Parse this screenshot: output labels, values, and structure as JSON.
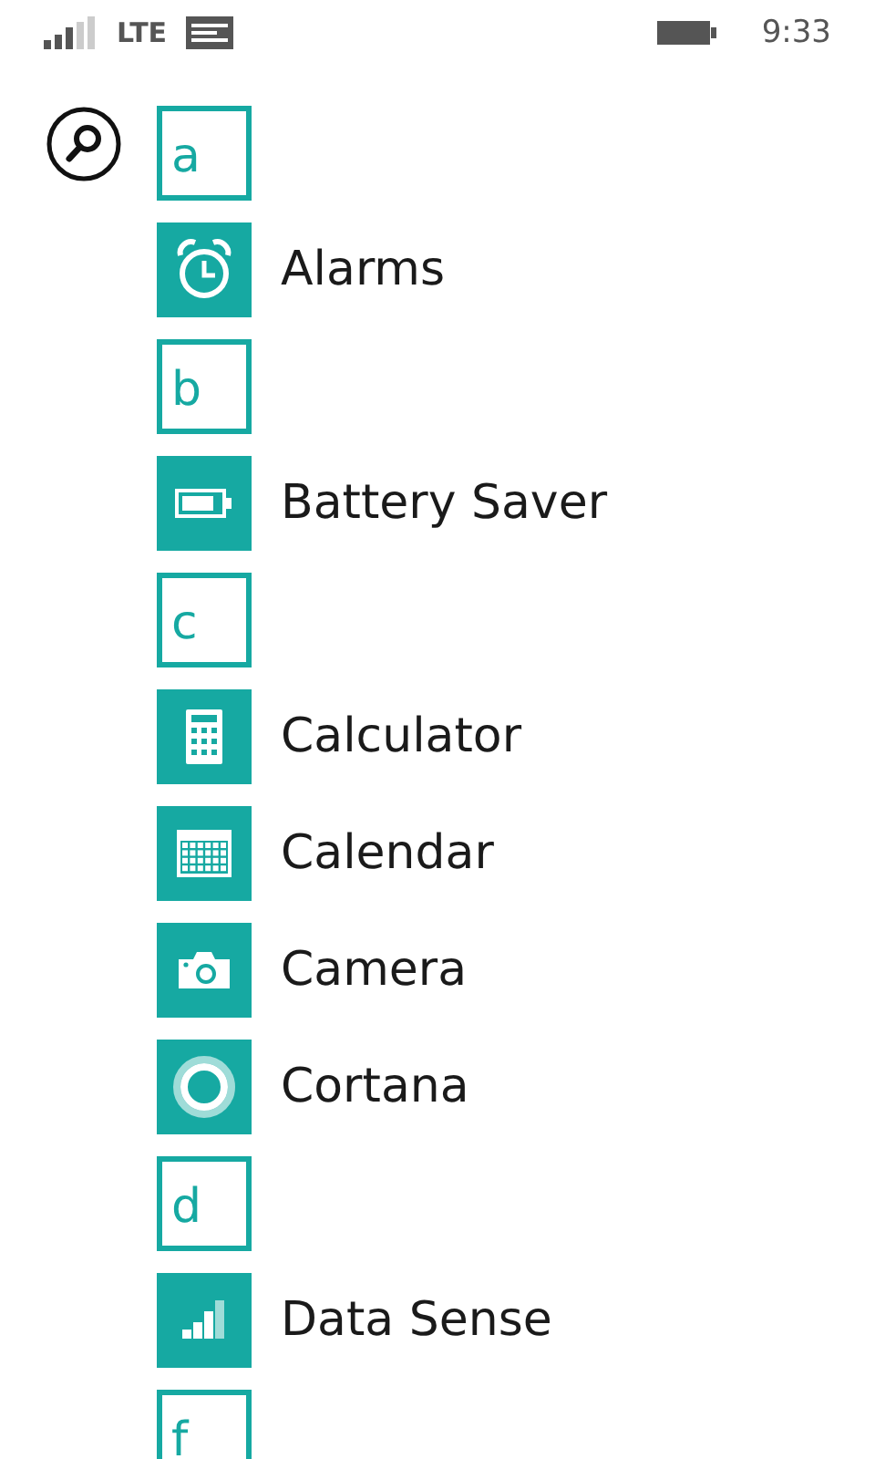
{
  "status_bar": {
    "network": "LTE",
    "time": "9:33"
  },
  "items": [
    {
      "kind": "header",
      "label": "a"
    },
    {
      "kind": "app",
      "label": "Alarms"
    },
    {
      "kind": "header",
      "label": "b"
    },
    {
      "kind": "app",
      "label": "Battery Saver"
    },
    {
      "kind": "header",
      "label": "c"
    },
    {
      "kind": "app",
      "label": "Calculator"
    },
    {
      "kind": "app",
      "label": "Calendar"
    },
    {
      "kind": "app",
      "label": "Camera"
    },
    {
      "kind": "app",
      "label": "Cortana"
    },
    {
      "kind": "header",
      "label": "d"
    },
    {
      "kind": "app",
      "label": "Data Sense"
    },
    {
      "kind": "header",
      "label": "f"
    }
  ]
}
